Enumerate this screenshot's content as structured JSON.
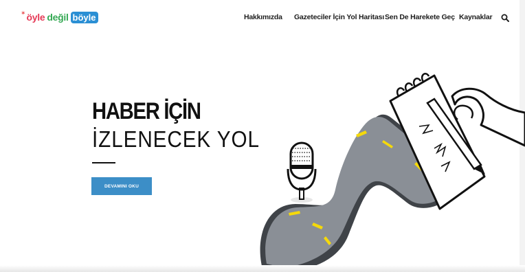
{
  "logo": {
    "part1": "öyle",
    "part2": "değil",
    "part3": "böyle"
  },
  "nav": {
    "items": [
      {
        "label": "Hakkımızda"
      },
      {
        "label": "Gazeteciler İçin Yol Haritası"
      },
      {
        "label": "Sen De Harekete Geç"
      },
      {
        "label": "Kaynaklar"
      }
    ],
    "search_icon": "search-icon"
  },
  "hero": {
    "title_line1": "HABER İÇİN",
    "title_line2": "İZLENECEK YOL",
    "cta_label": "DEVAMINI OKU"
  },
  "colors": {
    "logo_red": "#e63a57",
    "logo_green": "#34a853",
    "logo_blue": "#2b8fd4",
    "cta_blue": "#3c8ec7",
    "road_gray": "#8a8f96",
    "road_dash": "#f5d90a"
  },
  "illustration": {
    "description_icons": [
      "microphone-icon",
      "notepad-icon",
      "pencil-icon",
      "hand-icon",
      "road-icon"
    ]
  }
}
